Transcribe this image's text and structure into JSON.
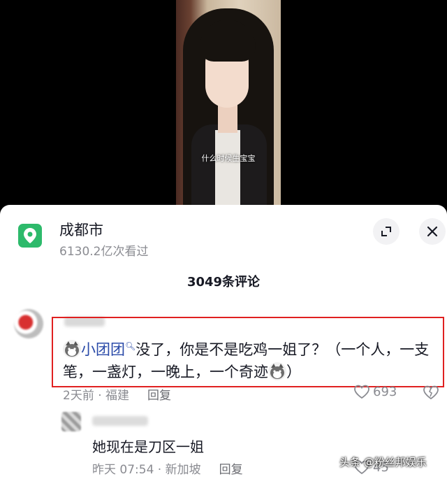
{
  "video": {
    "subtitle": "什么时候生宝宝"
  },
  "location": {
    "icon": "location-pin-icon",
    "name": "成都市",
    "views": "6130.2亿次看过"
  },
  "header": {
    "comment_count": "3049条评论",
    "expand_icon": "expand-icon",
    "close_icon": "close-icon"
  },
  "comments": [
    {
      "mention": "小团团",
      "text_part1": "没了，你是不是吃鸡一姐了？（一个人，一支笔，一盏灯，一晚上，一个奇迹",
      "text_part2": "）",
      "time_location": "2天前 · 福建",
      "reply_label": "回复",
      "likes": "693"
    },
    {
      "text": "她现在是刀区一姐",
      "time_location": "昨天 07:54 · 新加坡",
      "reply_label": "回复",
      "likes": "45"
    }
  ],
  "watermark": "头条 @粉丝邦娱乐",
  "colors": {
    "accent_green": "#2dba6b",
    "highlight_red": "#e02020",
    "mention_blue": "#2a4aa8"
  }
}
